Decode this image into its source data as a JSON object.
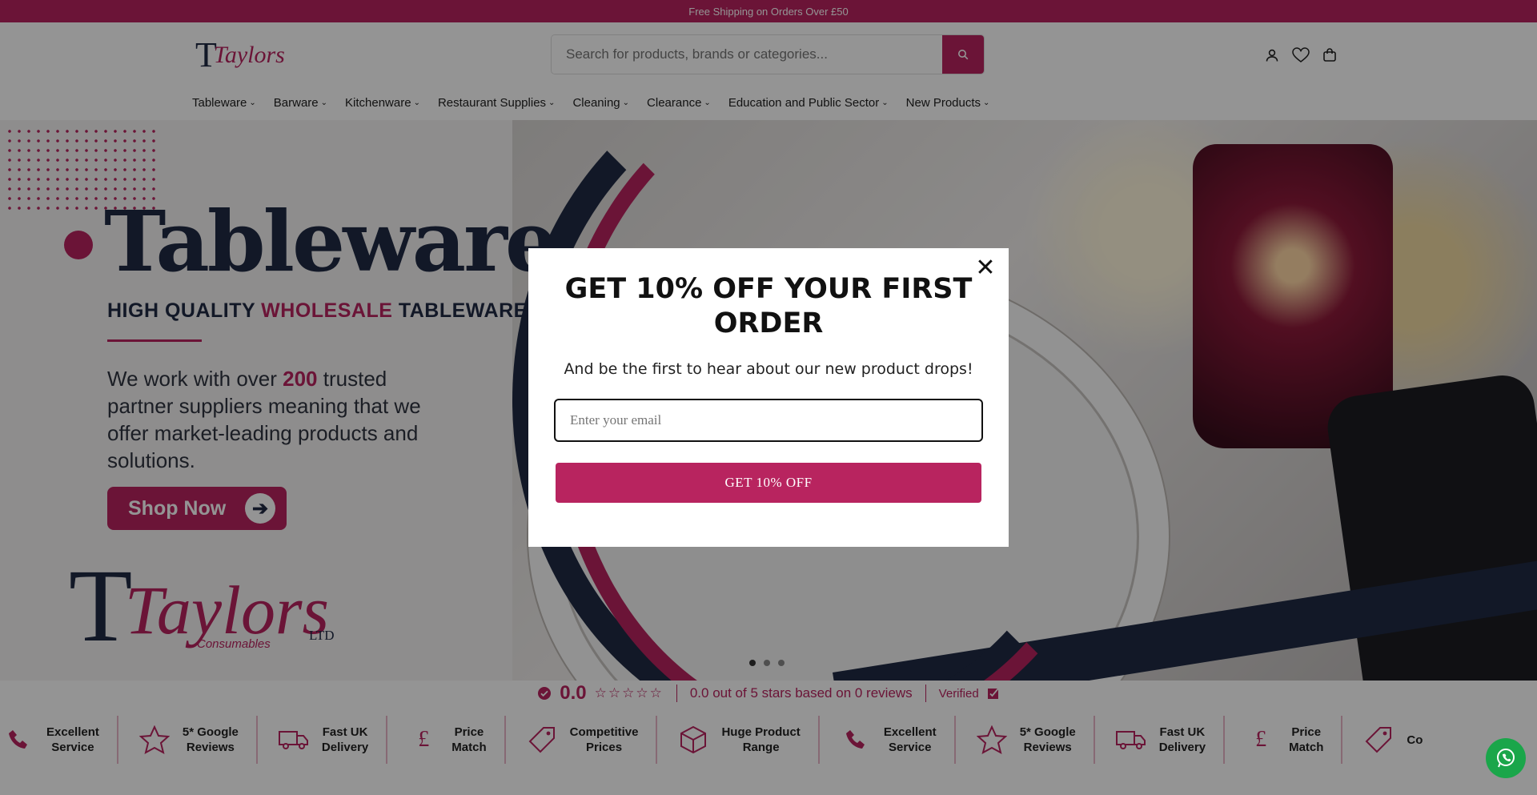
{
  "topbar": {
    "text": "Free Shipping on Orders Over £50"
  },
  "header": {
    "logo": {
      "mark": "T",
      "name": "Taylors"
    },
    "search": {
      "placeholder": "Search for products, brands or categories..."
    },
    "icons": [
      "user-icon",
      "heart-icon",
      "bag-icon"
    ]
  },
  "nav": [
    {
      "label": "Tableware"
    },
    {
      "label": "Barware"
    },
    {
      "label": "Kitchenware"
    },
    {
      "label": "Restaurant Supplies"
    },
    {
      "label": "Cleaning"
    },
    {
      "label": "Clearance"
    },
    {
      "label": "Education and Public Sector"
    },
    {
      "label": "New Products"
    }
  ],
  "hero": {
    "title": "Tableware",
    "subtitle_pre": "HIGH QUALITY ",
    "subtitle_accent": "WHOLESALE",
    "subtitle_post": " TABLEWARE",
    "body_pre": "We work with over ",
    "body_num": "200",
    "body_post": " trusted partner suppliers meaning that we offer market-leading products and solutions.",
    "cta": "Shop Now",
    "brand_mark": "T",
    "brand_name": "Taylors",
    "brand_sub": "Consumables",
    "brand_ltd": "LTD",
    "slides": 3,
    "active_slide": 1
  },
  "reviews": {
    "score": "0.0",
    "stars": "☆☆☆☆☆",
    "summary": "0.0 out of 5 stars based on 0 reviews",
    "verified": "Verified"
  },
  "features": [
    {
      "icon": "phone-icon",
      "label": "Excellent\nService"
    },
    {
      "icon": "star-icon",
      "label": "5* Google\nReviews"
    },
    {
      "icon": "truck-icon",
      "label": "Fast UK\nDelivery"
    },
    {
      "icon": "pound-icon",
      "label": "Price\nMatch"
    },
    {
      "icon": "tag-icon",
      "label": "Competitive\nPrices"
    },
    {
      "icon": "box-icon",
      "label": "Huge Product\nRange"
    },
    {
      "icon": "phone-icon",
      "label": "Excellent\nService"
    },
    {
      "icon": "star-icon",
      "label": "5* Google\nReviews"
    },
    {
      "icon": "truck-icon",
      "label": "Fast UK\nDelivery"
    },
    {
      "icon": "pound-icon",
      "label": "Price\nMatch"
    },
    {
      "icon": "tag-icon",
      "label": "Co"
    }
  ],
  "modal": {
    "title": "GET 10% OFF YOUR FIRST ORDER",
    "subtitle": "And be the first to hear about our new product drops!",
    "email_placeholder": "Enter your email",
    "cta": "GET 10% OFF",
    "close": "✕"
  },
  "colors": {
    "brand": "#b8245f",
    "navy": "#1f2a44",
    "whatsapp": "#1aa64a"
  }
}
